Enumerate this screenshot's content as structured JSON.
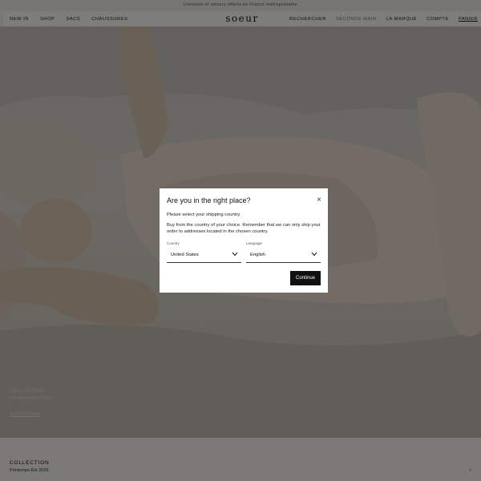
{
  "announcement": "Livraison et retours offerts en France métropolitaine",
  "header": {
    "logo": "soeur",
    "nav_left": [
      "NEW IN",
      "SHOP",
      "SACS",
      "CHAUSSURES"
    ],
    "nav_right": [
      "RECHERCHER",
      "SECONDE MAIN",
      "LA MARQUE",
      "COMPTE",
      "PANIER"
    ]
  },
  "hero": {
    "title": "COLLECTION",
    "subtitle": "Printemps-Été 2026",
    "link": "DÉCOUVRIR"
  },
  "strip": {
    "title": "COLLECTION",
    "subtitle": "Printemps-Été 2026",
    "arrow": "›"
  },
  "modal": {
    "title": "Are you in the right place?",
    "close": "×",
    "text1": "Please select your shipping country.",
    "text2": "Buy from the country of your choice. Remember that we can only ship your order to addresses located in the chosen country.",
    "country_label": "Country",
    "country_value": "United States",
    "language_label": "Language",
    "language_value": "English",
    "continue": "Continue"
  },
  "colors": {
    "accent": "#8a7a56",
    "button": "#111111"
  }
}
